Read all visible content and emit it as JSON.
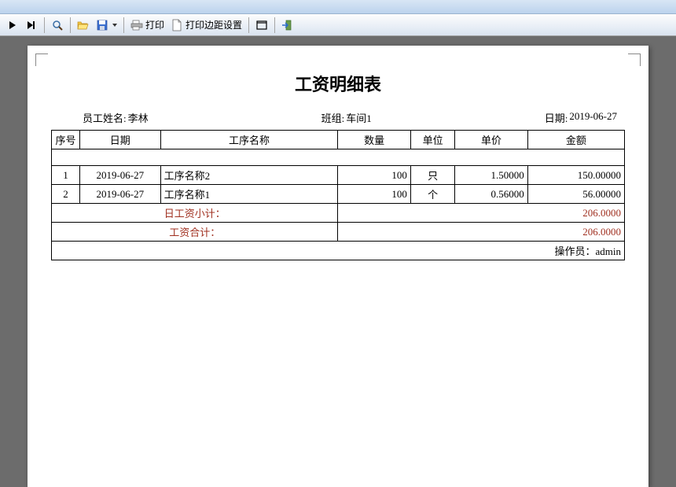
{
  "toolbar": {
    "print_label": "打印",
    "margin_label": "打印边距设置"
  },
  "report": {
    "title": "工资明细表",
    "employee_label": "员工姓名:",
    "employee_value": "李林",
    "team_label": "班组:",
    "team_value": "车间1",
    "date_label": "日期:",
    "date_value": "2019-06-27",
    "columns": {
      "idx": "序号",
      "date": "日期",
      "name": "工序名称",
      "qty": "数量",
      "unit": "单位",
      "price": "单价",
      "amount": "金额"
    },
    "rows": [
      {
        "idx": "1",
        "date": "2019-06-27",
        "name": "工序名称2",
        "qty": "100",
        "unit": "只",
        "price": "1.50000",
        "amount": "150.00000"
      },
      {
        "idx": "2",
        "date": "2019-06-27",
        "name": "工序名称1",
        "qty": "100",
        "unit": "个",
        "price": "0.56000",
        "amount": "56.00000"
      }
    ],
    "daily_subtotal_label": "日工资小计：",
    "daily_subtotal_value": "206.0000",
    "total_label": "工资合计：",
    "total_value": "206.0000",
    "operator_label": "操作员：",
    "operator_value": "admin"
  }
}
